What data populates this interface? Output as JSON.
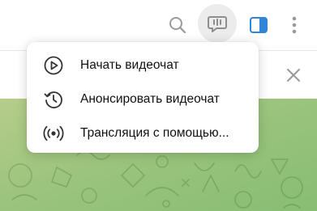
{
  "header": {
    "icons": {
      "search": "search-icon",
      "videochat": "videochat-icon",
      "side_panel": "side-panel-icon",
      "more": "more-vertical-icon"
    },
    "accent_color": "#2f86d8"
  },
  "pinned_bar": {
    "close_icon": "close-icon"
  },
  "videochat_menu": {
    "items": [
      {
        "label": "Начать видеочат",
        "icon": "play-circle-icon"
      },
      {
        "label": "Анонсировать видеочат",
        "icon": "clock-history-icon"
      },
      {
        "label": "Трансляция с помощью...",
        "icon": "broadcast-icon"
      }
    ]
  },
  "wallpaper": {
    "colors": [
      "#b6cd8a",
      "#9cc47e",
      "#88bd74"
    ]
  }
}
